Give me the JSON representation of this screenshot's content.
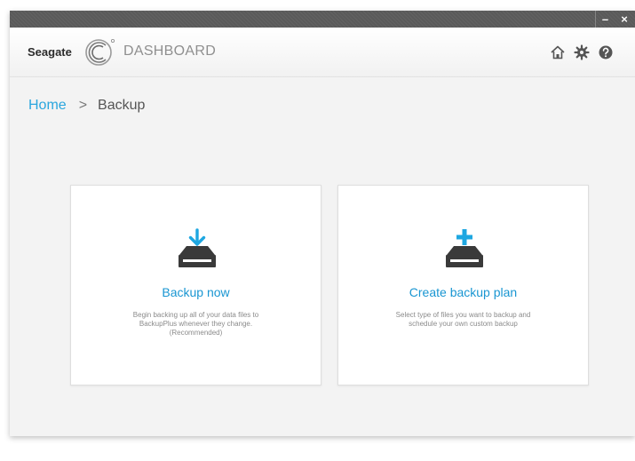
{
  "window": {
    "minimize_label": "–",
    "close_label": "×"
  },
  "header": {
    "brand": "Seagate",
    "product": "DASHBOARD",
    "icons": [
      "home-icon",
      "gear-icon",
      "help-icon"
    ]
  },
  "breadcrumb": {
    "home": "Home",
    "separator": ">",
    "current": "Backup"
  },
  "cards": [
    {
      "title": "Backup now",
      "description_lines": [
        "Begin backing up all of your data files to",
        "BackupPlus whenever they change.",
        "(Recommended)"
      ],
      "icon": "download-drive-icon"
    },
    {
      "title": "Create backup plan",
      "description_lines": [
        "Select type of files you want to backup and",
        "schedule your own custom backup"
      ],
      "icon": "add-drive-icon"
    }
  ],
  "colors": {
    "accent": "#1996d2",
    "link": "#2aa6de",
    "icon_dark": "#3a3a3a",
    "titlebar": "#5a5a5a"
  }
}
